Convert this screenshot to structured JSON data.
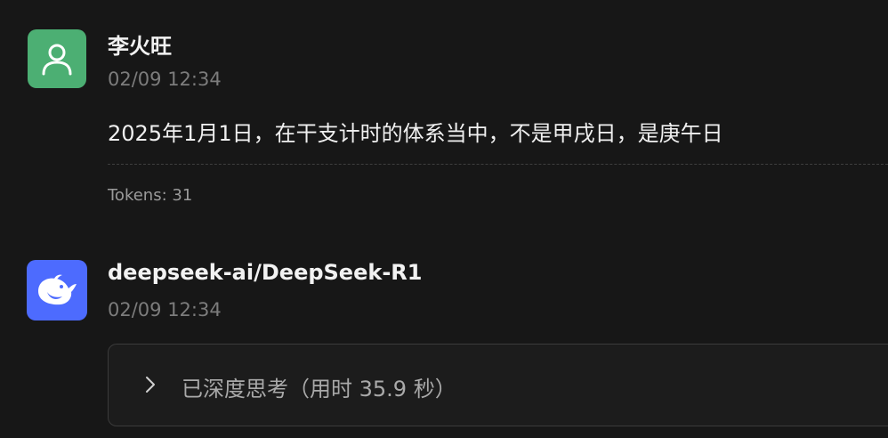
{
  "messages": [
    {
      "author": "李火旺",
      "time": "02/09 12:34",
      "content": "2025年1月1日，在干支计时的体系当中，不是甲戌日，是庚午日",
      "tokens": "Tokens: 31",
      "avatar_icon": "user-icon",
      "avatar_color": "#4caf73"
    },
    {
      "author": "deepseek-ai/DeepSeek-R1",
      "time": "02/09 12:34",
      "thinking_label": "已深度思考（用时 35.9 秒）",
      "avatar_icon": "deepseek-whale-icon",
      "avatar_color": "#4d6bfe"
    }
  ]
}
